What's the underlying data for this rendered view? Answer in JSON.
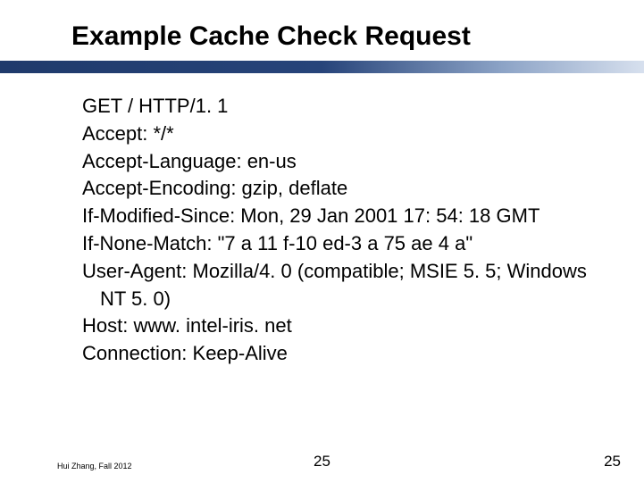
{
  "title": "Example Cache Check Request",
  "lines": [
    "GET / HTTP/1. 1",
    "Accept: */*",
    "Accept-Language: en-us",
    "Accept-Encoding: gzip, deflate",
    "If-Modified-Since: Mon, 29 Jan 2001 17: 54: 18 GMT",
    "If-None-Match: \"7 a 11 f-10 ed-3 a 75 ae 4 a\"",
    "User-Agent: Mozilla/4. 0 (compatible; MSIE 5. 5; Windows NT 5. 0)",
    "Host: www. intel-iris. net",
    "Connection: Keep-Alive"
  ],
  "footer": {
    "left": "Hui Zhang, Fall 2012",
    "center": "25",
    "right": "25"
  }
}
